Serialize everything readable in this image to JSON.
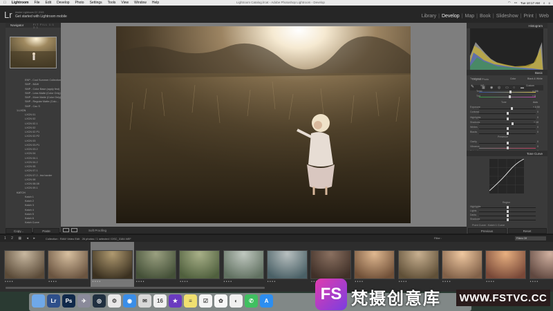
{
  "menubar": {
    "app": "Lightroom",
    "items": [
      "File",
      "Edit",
      "Develop",
      "Photo",
      "Settings",
      "Tools",
      "View",
      "Window",
      "Help"
    ],
    "window_title": "Lightroom Catalog.lrcat - Adobe Photoshop Lightroom - Develop",
    "time": "Tue 10:17 AM"
  },
  "identity": {
    "logo": "Lr",
    "sub": "Adobe Lightroom CC 2015",
    "main": "Get started with Lightroom mobile"
  },
  "modules": [
    "Library",
    "Develop",
    "Map",
    "Book",
    "Slideshow",
    "Print",
    "Web"
  ],
  "modules_active": "Develop",
  "left": {
    "navigator_title": "Navigator",
    "navigator_options": "FIT  FILL  1:1  3:1",
    "presets": [
      {
        "label": "ENP - Cool Summer Collection",
        "folder": false
      },
      {
        "label": "SMP - B&W",
        "folder": false
      },
      {
        "label": "SMP - Color Base (apply first)",
        "folder": false
      },
      {
        "label": "SMP - Less Matte (Color Only)",
        "folder": false
      },
      {
        "label": "SMP - More Matte (Color Only)",
        "folder": false
      },
      {
        "label": "SMP - Regular Matte (Colo...",
        "folder": false
      },
      {
        "label": "SMP - Cac S",
        "folder": false
      },
      {
        "label": "1.LXCN",
        "folder": true
      },
      {
        "label": "LXCN 01",
        "folder": false
      },
      {
        "label": "LXCN 02",
        "folder": false
      },
      {
        "label": "LXCN 02.1",
        "folder": false
      },
      {
        "label": "LXCN 02",
        "folder": false
      },
      {
        "label": "LXCN 02 P1",
        "folder": false
      },
      {
        "label": "LXCN 02.P2",
        "folder": false
      },
      {
        "label": "LXCN 03",
        "folder": false
      },
      {
        "label": "LXCN 03.P1",
        "folder": false
      },
      {
        "label": "LXCN 03.2",
        "folder": false
      },
      {
        "label": "LXCN 04",
        "folder": false
      },
      {
        "label": "LXCN 04.1",
        "folder": false
      },
      {
        "label": "LXCN 04.2",
        "folder": false
      },
      {
        "label": "LXCN 05",
        "folder": false
      },
      {
        "label": "LXCN 07.1",
        "folder": false
      },
      {
        "label": "LXCN 07.2 - tea harder",
        "folder": false
      },
      {
        "label": "LXCN 08",
        "folder": false
      },
      {
        "label": "LXCN 08.08",
        "folder": false
      },
      {
        "label": "LXCN 09.1",
        "folder": false
      },
      {
        "label": "KATCH",
        "folder": true
      },
      {
        "label": "Katch 1",
        "folder": false
      },
      {
        "label": "Katch 2",
        "folder": false
      },
      {
        "label": "Katch 3",
        "folder": false
      },
      {
        "label": "Katch 4",
        "folder": false
      },
      {
        "label": "Katch 5",
        "folder": false
      },
      {
        "label": "Katch 6",
        "folder": false
      },
      {
        "label": "Katch Curve",
        "folder": false
      }
    ],
    "copy_label": "Copy...",
    "paste_label": "Paste"
  },
  "toolbar": {
    "soft_proofing": "Soft Proofing"
  },
  "right": {
    "histogram_title": "Histogram",
    "original_photo": "Original Photo",
    "basic_title": "Basic",
    "treatment_label": "Treatment :",
    "treatment_color": "Color",
    "treatment_bw": "Black & White",
    "wb_label": "WB :",
    "wb_value": "Custom",
    "temp_label": "Temp",
    "temp_value": "4,396",
    "tint_label": "Tint",
    "tint_value": "+ 8",
    "tone_label": "Tone",
    "tone_auto": "Auto",
    "exposure_label": "Exposure",
    "exposure_value": "+ 0.50",
    "contrast_label": "Contrast",
    "contrast_value": "0",
    "highlights_label": "Highlights",
    "highlights_value": "0",
    "shadows_label": "Shadows",
    "shadows_value": "+ 18",
    "whites_label": "Whites",
    "whites_value": "0",
    "blacks_label": "Blacks",
    "blacks_value": "0",
    "presence_label": "Presence",
    "clarity_label": "Clarity",
    "clarity_value": "0",
    "vibrance_label": "Vibrance",
    "vibrance_value": "0",
    "saturation_label": "Saturation",
    "saturation_value": "0",
    "tonecurve_title": "Tone Curve",
    "region_label": "Region",
    "highlights_r": "Highlights",
    "lights_r": "Lights",
    "darks_r": "Darks",
    "shadows_r": "Shadows",
    "point_curve": "Point Curve : Katch 1 Curve",
    "previous_label": "Previous",
    "reset_label": "Reset"
  },
  "filmstrip": {
    "collection": "Collection : RAW Video Edit",
    "count": "26 photos / 1 selected / DSC_3184.NEF",
    "filter_label": "Filter :",
    "filter_value": "Filters Off",
    "selected_index": 2,
    "badge": "● ● ● ●"
  },
  "watermark": {
    "logo": "FS",
    "chinese": "梵摄创意库",
    "url": "WWW.FSTVC.CC"
  },
  "dock_icons": [
    "finder-icon",
    "lightroom-icon",
    "photoshop-icon",
    "launchpad-icon",
    "steam-icon",
    "app-icon",
    "safari-icon",
    "mail-icon",
    "calendar-icon",
    "imovie-icon",
    "notes-icon",
    "reminders-icon",
    "photos-icon",
    "chrome-icon",
    "messages-icon",
    "app-store-icon"
  ],
  "colors": {
    "lr_blue": "#2e4f8a",
    "ps_blue": "#10294a",
    "accent": "#e03cae"
  }
}
